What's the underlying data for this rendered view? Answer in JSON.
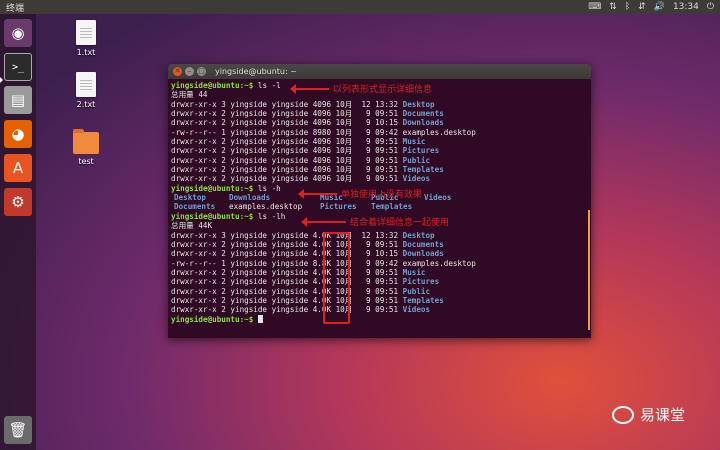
{
  "top_panel": {
    "title": "终端",
    "time": "13:34",
    "tray_icons": [
      "keyboard-icon",
      "sort-icon",
      "bluetooth-icon",
      "network-icon",
      "volume-icon",
      "power-icon"
    ]
  },
  "launcher": {
    "items": [
      {
        "name": "ubuntu-logo",
        "glyph": "◉",
        "color": "#6a3b6a"
      },
      {
        "name": "terminal-icon",
        "glyph": ">_",
        "color": "#2b2b2b"
      },
      {
        "name": "files-icon",
        "glyph": "▤",
        "color": "#9a9a9a"
      },
      {
        "name": "firefox-icon",
        "glyph": "◕",
        "color": "#e66000"
      },
      {
        "name": "software-center-icon",
        "glyph": "A",
        "color": "#e95420"
      },
      {
        "name": "settings-icon",
        "glyph": "⚙",
        "color": "#c0392b"
      },
      {
        "name": "trash-icon",
        "glyph": "🗑",
        "color": "#6b6b6b"
      }
    ]
  },
  "desktop_icons": [
    {
      "label": "1.txt",
      "type": "file"
    },
    {
      "label": "2.txt",
      "type": "file"
    },
    {
      "label": "test",
      "type": "folder"
    }
  ],
  "terminal": {
    "title": "yingside@ubuntu: ~",
    "lines": [
      {
        "prompt": "yingside@ubuntu:~$",
        "cmd": " ls -l"
      },
      {
        "text": "总用量 44"
      },
      {
        "text": "drwxr-xr-x 3 yingside yingside 4096 10月  12 13:32 ",
        "name": "Desktop"
      },
      {
        "text": "drwxr-xr-x 2 yingside yingside 4096 10月   9 09:51 ",
        "name": "Documents"
      },
      {
        "text": "drwxr-xr-x 2 yingside yingside 4096 10月   9 10:15 ",
        "name": "Downloads"
      },
      {
        "text": "-rw-r--r-- 1 yingside yingside 8980 10月   9 09:42 examples.desktop"
      },
      {
        "text": "drwxr-xr-x 2 yingside yingside 4096 10月   9 09:51 ",
        "name": "Music"
      },
      {
        "text": "drwxr-xr-x 2 yingside yingside 4096 10月   9 09:51 ",
        "name": "Pictures"
      },
      {
        "text": "drwxr-xr-x 2 yingside yingside 4096 10月   9 09:51 ",
        "name": "Public"
      },
      {
        "text": "drwxr-xr-x 2 yingside yingside 4096 10月   9 09:51 ",
        "name": "Templates"
      },
      {
        "text": "drwxr-xr-x 2 yingside yingside 4096 10月   9 09:51 ",
        "name": "Videos"
      },
      {
        "prompt": "yingside@ubuntu:~$",
        "cmd": " ls -h"
      },
      {
        "cols": [
          [
            "Desktop",
            "Downloads",
            "Music",
            "Public",
            "Videos"
          ],
          [
            "Documents",
            "examples.desktop",
            "Pictures",
            "Templates"
          ]
        ]
      },
      {
        "prompt": "yingside@ubuntu:~$",
        "cmd": " ls -lh"
      },
      {
        "text": "总用量 44K"
      },
      {
        "text": "drwxr-xr-x 3 yingside yingside 4.0K 10月  12 13:32 ",
        "name": "Desktop"
      },
      {
        "text": "drwxr-xr-x 2 yingside yingside 4.0K 10月   9 09:51 ",
        "name": "Documents"
      },
      {
        "text": "drwxr-xr-x 2 yingside yingside 4.0K 10月   9 10:15 ",
        "name": "Downloads"
      },
      {
        "text": "-rw-r--r-- 1 yingside yingside 8.8K 10月   9 09:42 examples.desktop"
      },
      {
        "text": "drwxr-xr-x 2 yingside yingside 4.0K 10月   9 09:51 ",
        "name": "Music"
      },
      {
        "text": "drwxr-xr-x 2 yingside yingside 4.0K 10月   9 09:51 ",
        "name": "Pictures"
      },
      {
        "text": "drwxr-xr-x 2 yingside yingside 4.0K 10月   9 09:51 ",
        "name": "Public"
      },
      {
        "text": "drwxr-xr-x 2 yingside yingside 4.0K 10月   9 09:51 ",
        "name": "Templates"
      },
      {
        "text": "drwxr-xr-x 2 yingside yingside 4.0K 10月   9 09:51 ",
        "name": "Videos"
      },
      {
        "prompt": "yingside@ubuntu:~$",
        "cmd": " ",
        "cursor": true
      }
    ]
  },
  "annotations": {
    "ls_l": "以列表形式显示详细信息",
    "ls_h": "单独使用-h没有效果",
    "ls_lh": "结合着详细信息一起使用"
  },
  "watermark": {
    "text": "易课堂"
  }
}
